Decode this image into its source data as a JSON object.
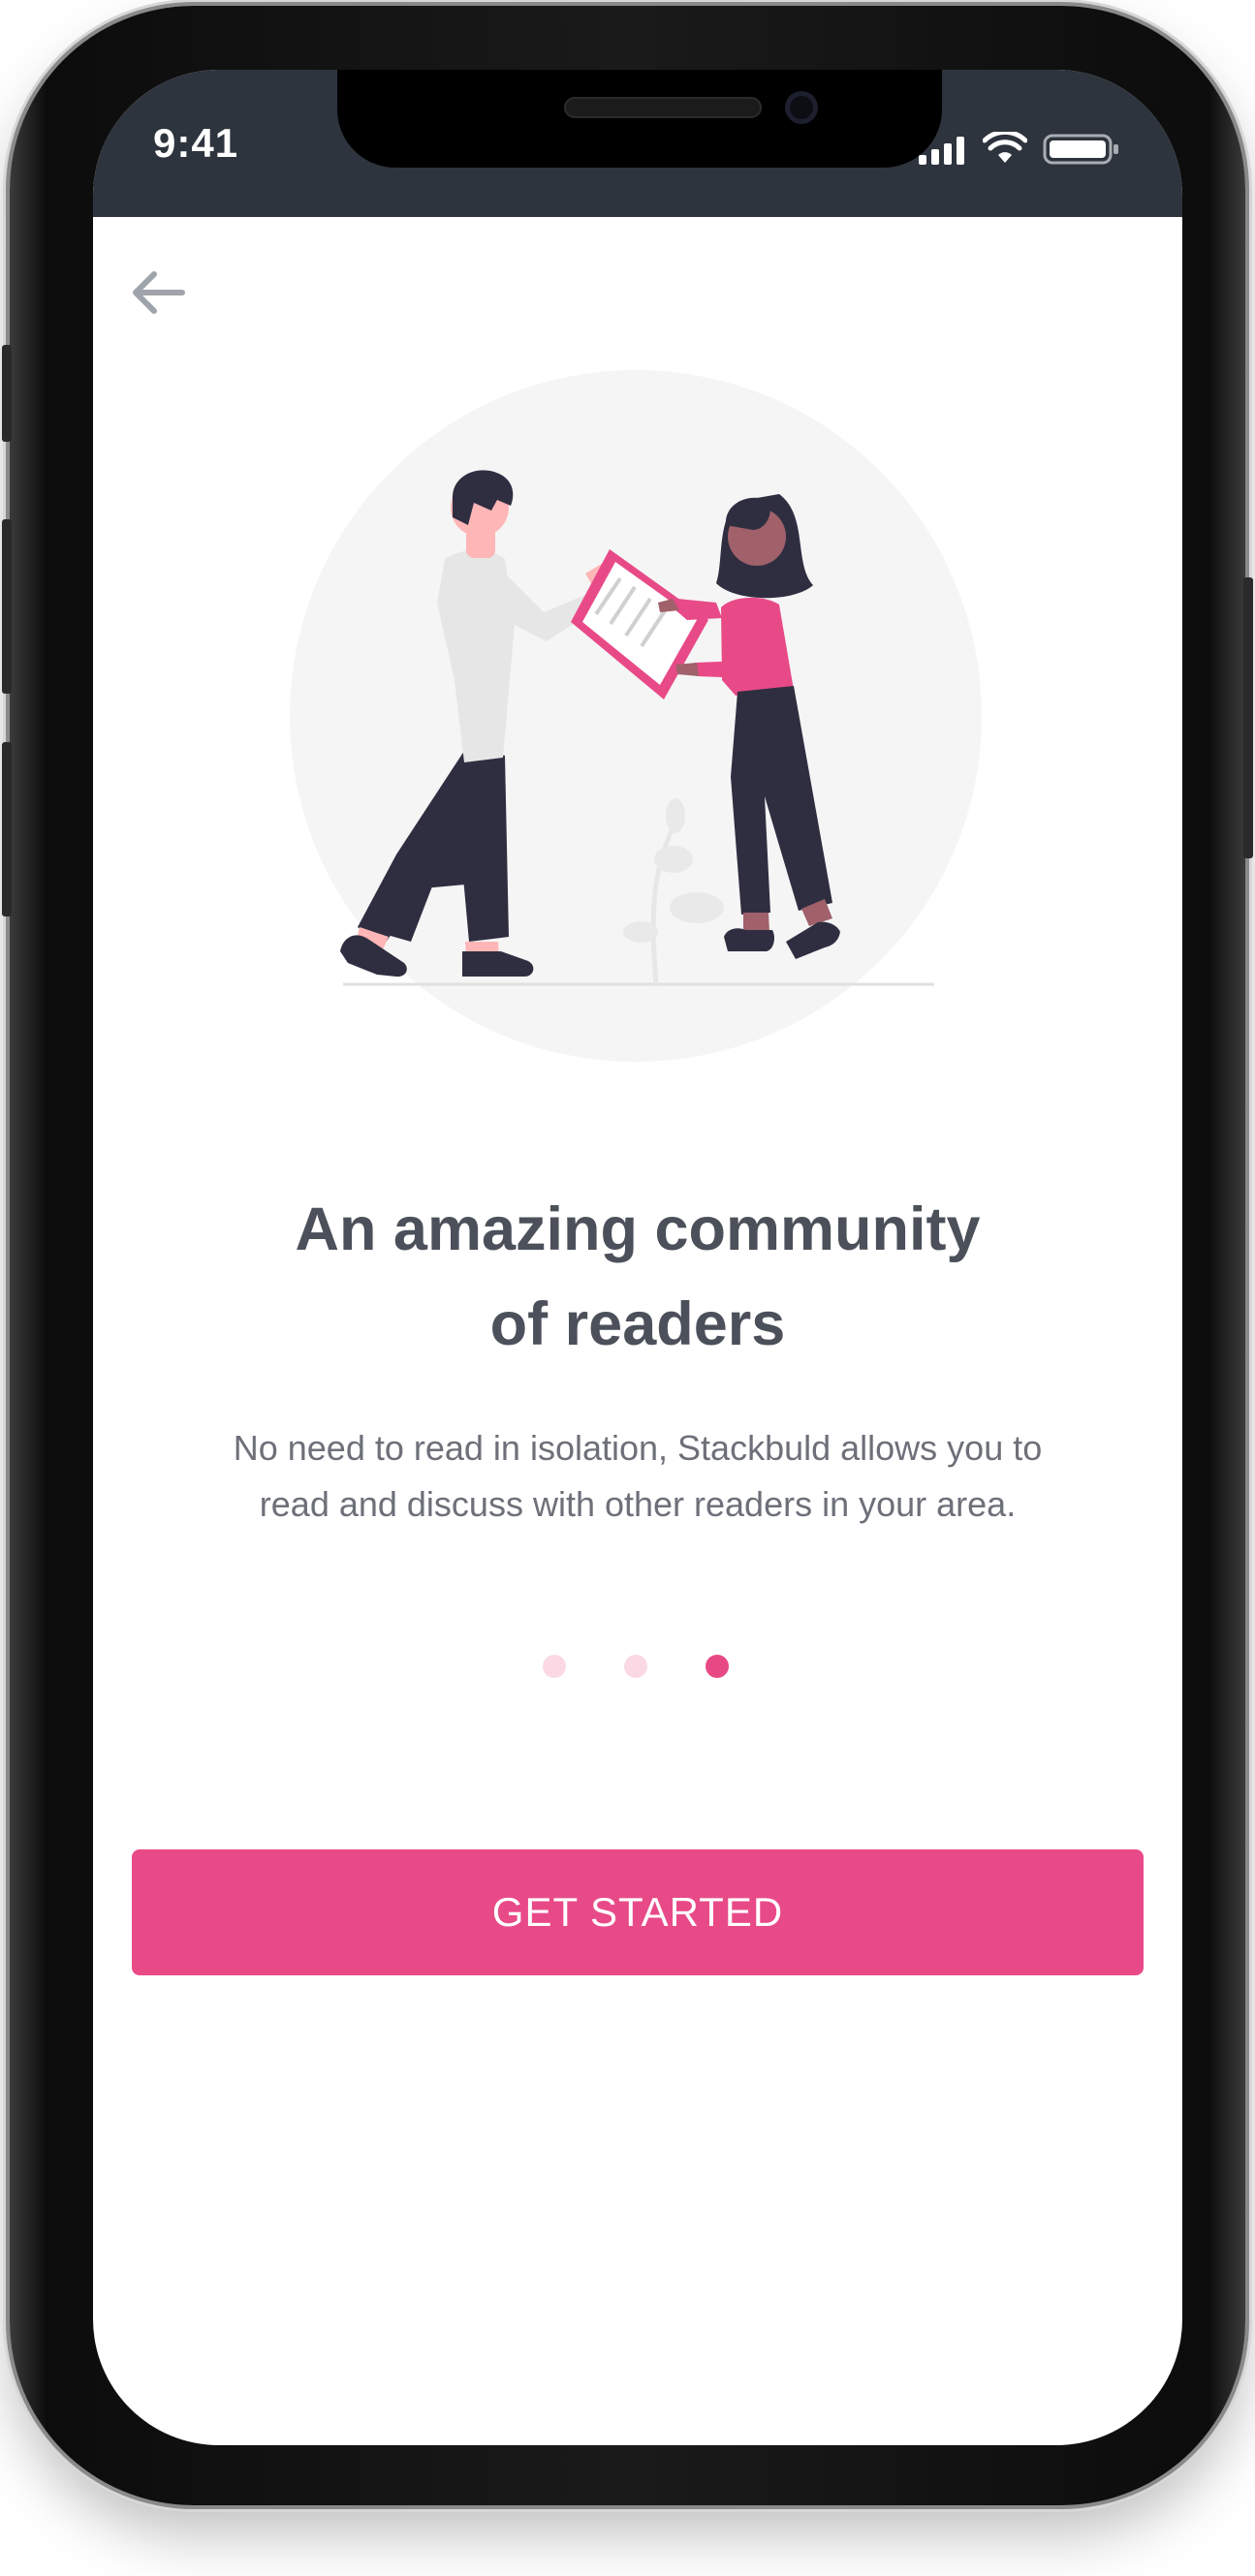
{
  "status_bar": {
    "time": "9:41",
    "icons": [
      "cellular-signal-icon",
      "wifi-icon",
      "battery-icon"
    ]
  },
  "header": {
    "back_icon": "arrow-left-icon"
  },
  "illustration": {
    "subject": "two-people-exchanging-document-illustration"
  },
  "onboarding": {
    "title_line1": "An amazing community",
    "title_line2": "of readers",
    "description_line1": "No need to read in isolation, Stackbuld allows you to",
    "description_line2": "read and discuss with other readers in your area.",
    "page_indicator": {
      "current": 3,
      "total": 3
    }
  },
  "cta": {
    "label": "GET STARTED"
  },
  "colors": {
    "accent": "#e84a88",
    "accent_light": "#fbd9e4",
    "status_bar": "#2e343d",
    "title_text": "#4b505a",
    "body_text": "#6d7079",
    "figure_dark": "#2f2e41"
  }
}
